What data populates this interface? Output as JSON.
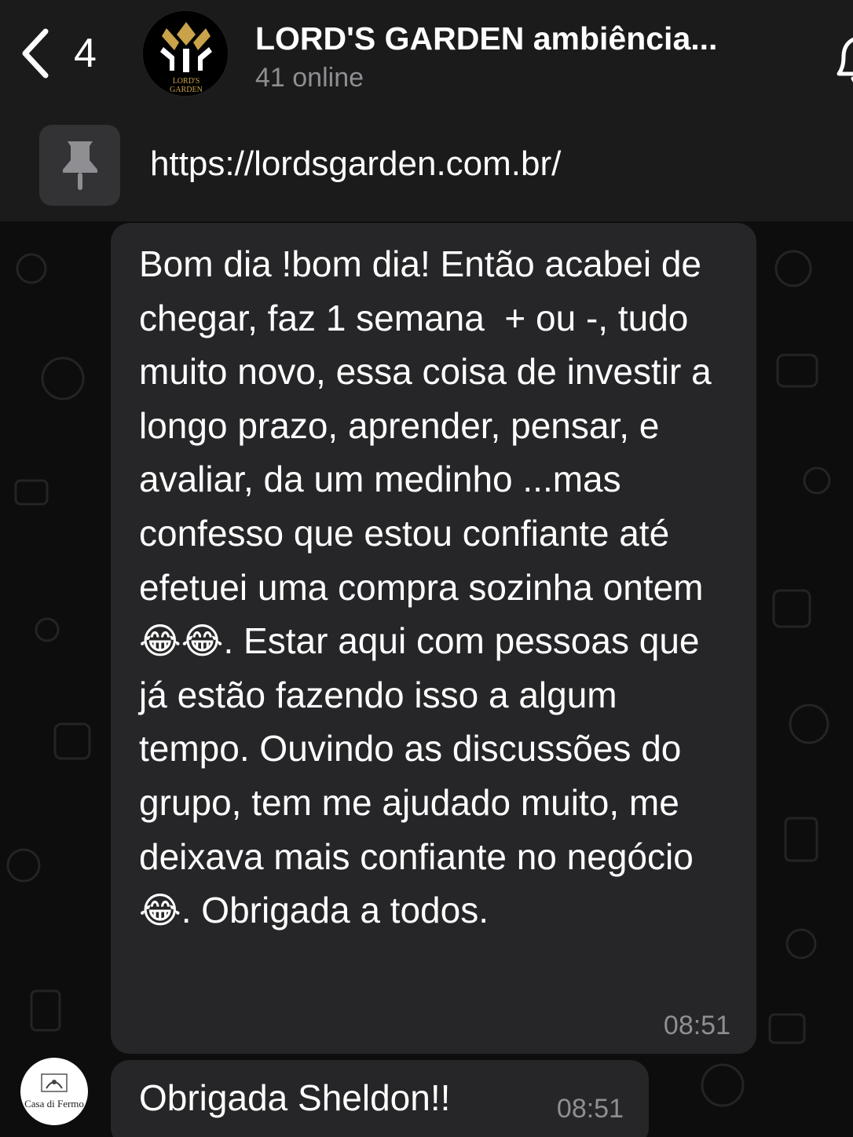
{
  "header": {
    "back_count": "4",
    "title": "LORD'S GARDEN ambiência...",
    "status": "41 online",
    "avatar_lines": [
      "LORD'S",
      "GARDEN"
    ],
    "back_icon": "chevron-left-icon",
    "bell_icon": "bell-icon"
  },
  "pinned": {
    "icon": "pin-icon",
    "text": "https://lordsgarden.com.br/"
  },
  "messages": [
    {
      "text": "Bom dia !bom dia! Então acabei de chegar, faz 1 semana  + ou -, tudo muito novo, essa coisa de investir a longo prazo, aprender, pensar, e avaliar, da um medinho ...mas confesso que estou confiante até efetuei uma compra sozinha ontem 😂😂. Estar aqui com pessoas que já estão fazendo isso a algum tempo. Ouvindo as discussões do grupo, tem me ajudado muito, me deixava mais confiante no negócio😂. Obrigada a todos.",
      "time": "08:51"
    },
    {
      "text": "Obrigada  Sheldon!!",
      "time": "08:51",
      "sender_avatar_text": "Casa di Fermo"
    }
  ],
  "colors": {
    "header_bg": "#1b1b1b",
    "bubble_bg": "#262628",
    "muted_text": "#8e8e93",
    "logo_gold": "#c9a24a"
  }
}
